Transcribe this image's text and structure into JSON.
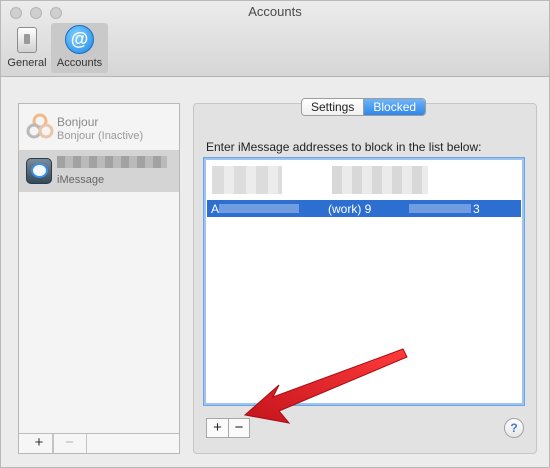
{
  "window": {
    "title": "Accounts"
  },
  "toolbar": {
    "general_label": "General",
    "accounts_label": "Accounts"
  },
  "accounts": [
    {
      "name": "Bonjour",
      "status": "Bonjour (Inactive)"
    },
    {
      "name": "",
      "status": "iMessage"
    }
  ],
  "accounts_footer": {
    "add": "+",
    "remove": "−"
  },
  "tabs": {
    "settings": "Settings",
    "blocked": "Blocked"
  },
  "blocked": {
    "instruction": "Enter iMessage addresses to block in the list below:",
    "selected_row": {
      "name_initial": "A",
      "phone_prefix": "(work) 9",
      "phone_suffix": "3"
    },
    "add": "+",
    "remove": "−"
  },
  "help_label": "?",
  "colors": {
    "accent": "#2d6fd0",
    "annotation_arrow": "#e8202a"
  }
}
